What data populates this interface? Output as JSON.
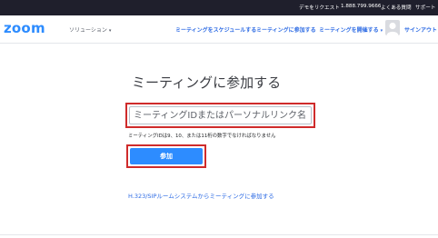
{
  "topbar": {
    "demo_request": "デモをリクエスト",
    "phone": "1.888.799.9666",
    "faq": "よくある質問",
    "support": "サポート"
  },
  "navbar": {
    "logo": "zoom",
    "solutions": "ソリューション",
    "schedule": "ミーティングをスケジュールする",
    "join": "ミーティングに参加する",
    "host": "ミーティングを開催する",
    "sign_out": "サインアウト"
  },
  "main": {
    "title": "ミーティングに参加する",
    "input_placeholder": "ミーティングIDまたはパーソナルリンク名",
    "helper_text": "ミーティングIDは9、10、または11桁の数字でなければなりません",
    "join_button": "参加",
    "h323_link": "H.323/SIPルームシステムからミーティングに参加する"
  },
  "icons": {
    "dropdown": "chevron-down-icon",
    "avatar": "user-avatar-icon"
  },
  "colors": {
    "brand": "#2d8cff",
    "topbar_bg": "#1f1f2c",
    "highlight": "#cf2b2b",
    "link": "#2d6be4"
  }
}
